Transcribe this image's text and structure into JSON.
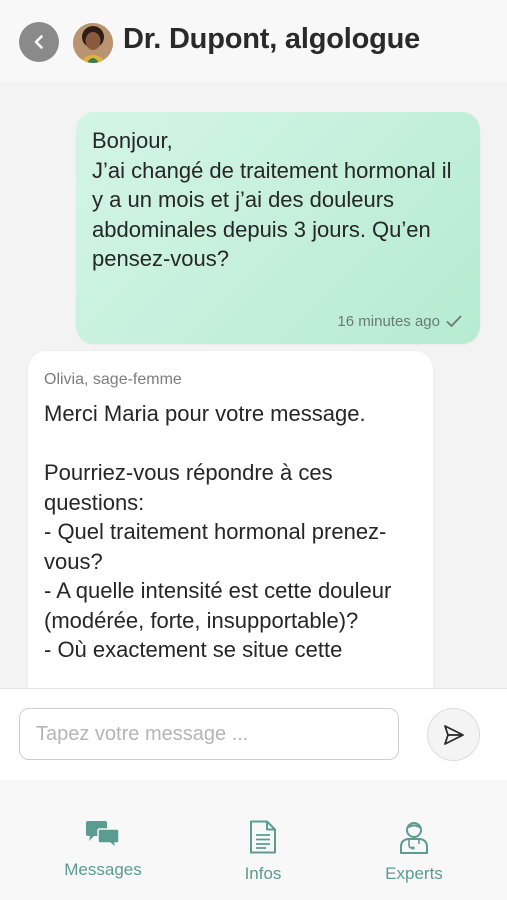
{
  "header": {
    "title": "Dr. Dupont, algologue",
    "back_icon": "chevron-left-icon",
    "avatar_icon": "avatar"
  },
  "messages": [
    {
      "direction": "sent",
      "text": "Bonjour,\nJ’ai changé de traitement hormonal il y a un mois et j’ai des douleurs abdominales depuis 3 jours. Qu’en pensez-vous?",
      "time": "16 minutes ago",
      "status_icon": "checkmark-icon"
    },
    {
      "direction": "received",
      "sender": "Olivia, sage-femme",
      "text": "Merci Maria pour votre message.\n\nPourriez-vous répondre à ces questions:\n- Quel traitement hormonal prenez-vous?\n- A quelle intensité est cette douleur (modérée, forte, insupportable)?\n- Où exactement se situe cette"
    }
  ],
  "composer": {
    "placeholder": "Tapez votre message ...",
    "value": "",
    "send_icon": "send-icon"
  },
  "tabs": [
    {
      "label": "Messages",
      "icon": "chat-bubbles-icon"
    },
    {
      "label": "Infos",
      "icon": "document-icon"
    },
    {
      "label": "Experts",
      "icon": "doctor-icon"
    }
  ],
  "colors": {
    "accent": "#5a9c92",
    "sent_bubble": "#c6f0dc",
    "received_bubble": "#ffffff",
    "back_button": "#8a8a8a"
  }
}
